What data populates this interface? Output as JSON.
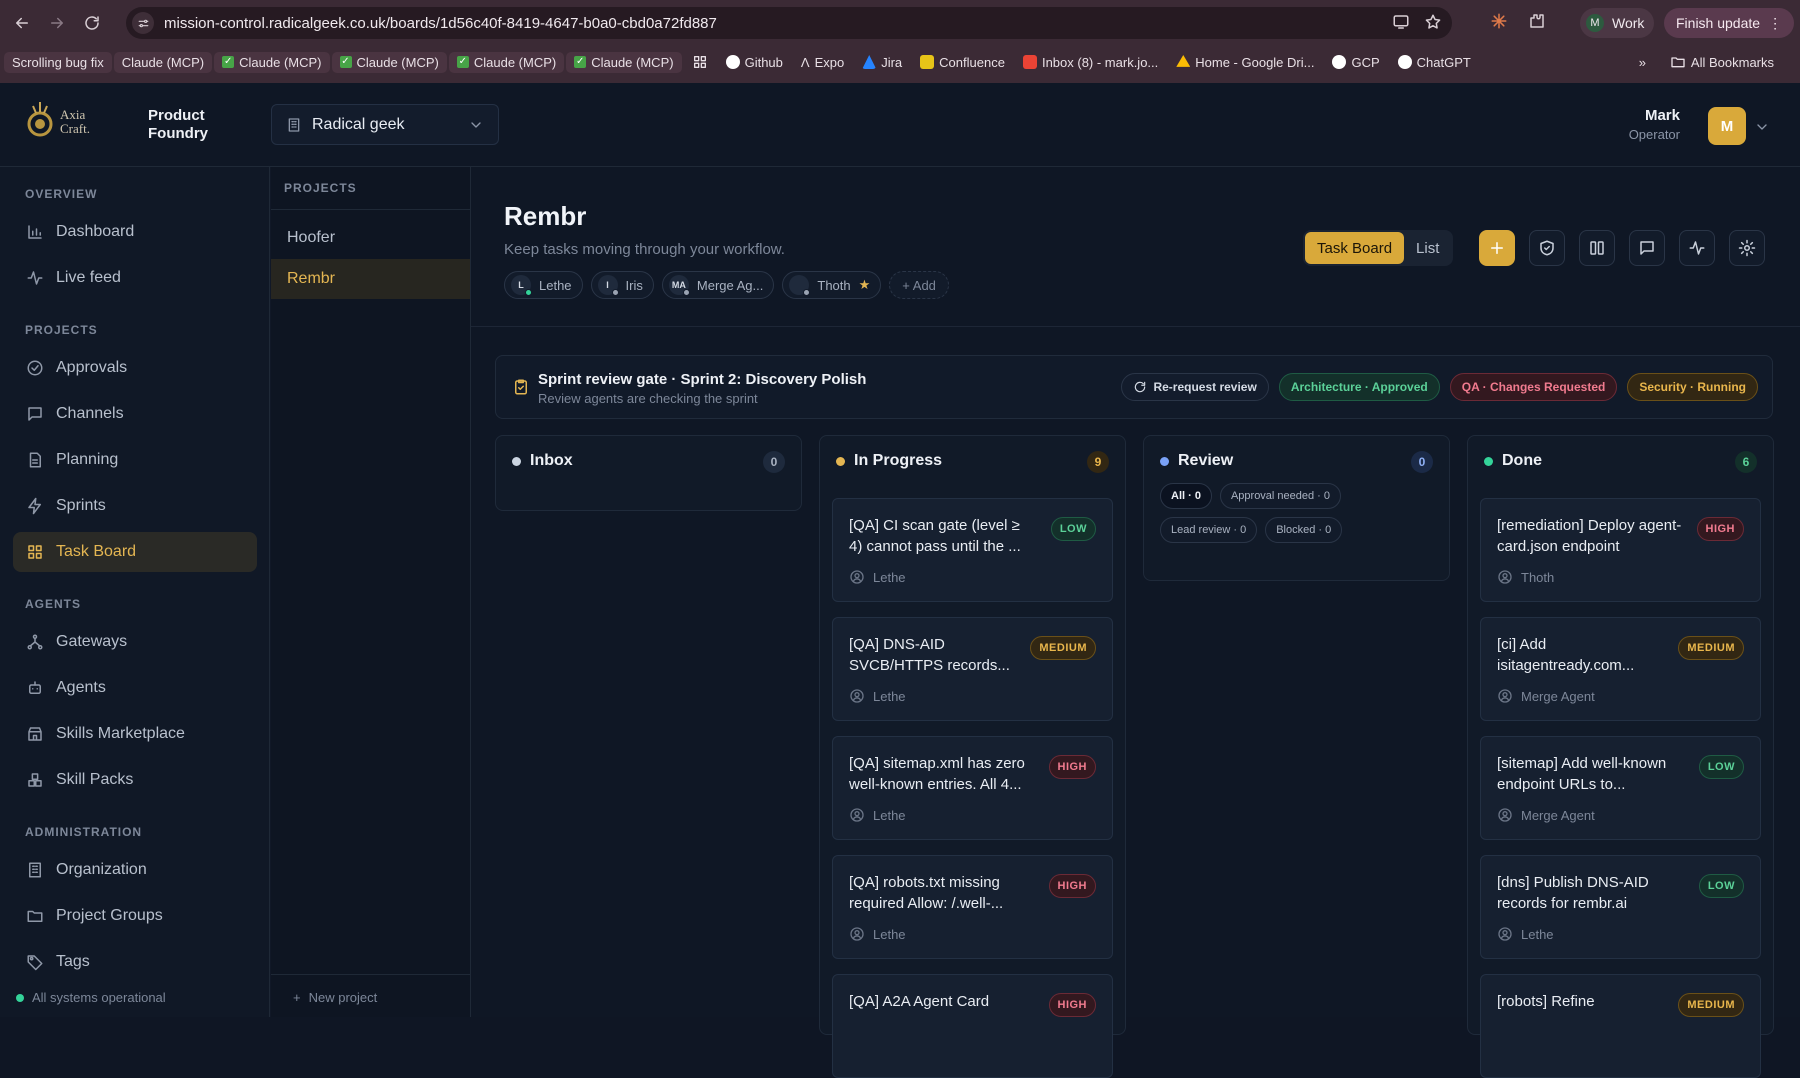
{
  "browser": {
    "url": "mission-control.radicalgeek.co.uk/boards/1d56c40f-8419-4647-b0a0-cbd0a72fd887",
    "profile_initial": "M",
    "profile_label": "Work",
    "finish_update": "Finish update",
    "bookmarks": [
      {
        "label": "Scrolling bug fix"
      },
      {
        "label": "Claude (MCP)"
      },
      {
        "label": "Claude (MCP)"
      },
      {
        "label": "Claude (MCP)"
      },
      {
        "label": "Claude (MCP)"
      },
      {
        "label": "Claude (MCP)"
      },
      {
        "label": "Github"
      },
      {
        "label": "Expo"
      },
      {
        "label": "Jira"
      },
      {
        "label": "Confluence"
      },
      {
        "label": "Inbox (8) - mark.jo..."
      },
      {
        "label": "Home - Google Dri..."
      },
      {
        "label": "GCP"
      },
      {
        "label": "ChatGPT"
      }
    ],
    "all_bookmarks": "All Bookmarks"
  },
  "header": {
    "logo_line1": "Axia",
    "logo_line2": "Craft.",
    "product": "Product Foundry",
    "org": "Radical geek",
    "user_name": "Mark",
    "user_role": "Operator",
    "user_initial": "M"
  },
  "sidebar": {
    "sections": {
      "overview": "OVERVIEW",
      "projects": "PROJECTS",
      "agents": "AGENTS",
      "administration": "ADMINISTRATION"
    },
    "items": {
      "dashboard": "Dashboard",
      "live_feed": "Live feed",
      "approvals": "Approvals",
      "channels": "Channels",
      "planning": "Planning",
      "sprints": "Sprints",
      "task_board": "Task Board",
      "gateways": "Gateways",
      "agents": "Agents",
      "skills_marketplace": "Skills Marketplace",
      "skill_packs": "Skill Packs",
      "organization": "Organization",
      "project_groups": "Project Groups",
      "tags": "Tags"
    },
    "status": "All systems operational"
  },
  "projects_panel": {
    "title": "PROJECTS",
    "items": [
      "Hoofer",
      "Rembr"
    ],
    "new_project": "New project"
  },
  "board": {
    "title": "Rembr",
    "subtitle": "Keep tasks moving through your workflow.",
    "agents": [
      {
        "initials": "L",
        "name": "Lethe"
      },
      {
        "initials": "I",
        "name": "Iris"
      },
      {
        "initials": "MA",
        "name": "Merge Ag..."
      },
      {
        "initials": "",
        "name": "Thoth"
      }
    ],
    "add_agent": "+ Add",
    "views": {
      "board": "Task Board",
      "list": "List"
    }
  },
  "gate": {
    "title": "Sprint review gate · Sprint 2: Discovery Polish",
    "subtitle": "Review agents are checking the sprint",
    "rerequest": "Re-request review",
    "architecture": "Architecture · Approved",
    "qa": "QA · Changes Requested",
    "security": "Security · Running"
  },
  "columns": {
    "inbox": {
      "title": "Inbox",
      "count": "0",
      "color": "#cbd5e1"
    },
    "in_progress": {
      "title": "In Progress",
      "count": "9",
      "color": "#e4b652",
      "cards": [
        {
          "title": "[QA] CI scan gate (level ≥ 4) cannot pass until the ...",
          "priority": "LOW",
          "assignee": "Lethe"
        },
        {
          "title": "[QA] DNS-AID SVCB/HTTPS records...",
          "priority": "MEDIUM",
          "assignee": "Lethe"
        },
        {
          "title": "[QA] sitemap.xml has zero well-known entries. All 4...",
          "priority": "HIGH",
          "assignee": "Lethe"
        },
        {
          "title": "[QA] robots.txt missing required Allow: /.well-...",
          "priority": "HIGH",
          "assignee": "Lethe"
        },
        {
          "title": "[QA] A2A Agent Card",
          "priority": "HIGH",
          "assignee": ""
        }
      ]
    },
    "review": {
      "title": "Review",
      "count": "0",
      "color": "#7aa2f7",
      "filters": {
        "all": "All · 0",
        "approval": "Approval needed · 0",
        "lead": "Lead review · 0",
        "blocked": "Blocked · 0"
      }
    },
    "done": {
      "title": "Done",
      "count": "6",
      "color": "#34d399",
      "cards": [
        {
          "title": "[remediation] Deploy agent-card.json endpoint",
          "priority": "HIGH",
          "assignee": "Thoth"
        },
        {
          "title": "[ci] Add isitagentready.com...",
          "priority": "MEDIUM",
          "assignee": "Merge Agent"
        },
        {
          "title": "[sitemap] Add well-known endpoint URLs to...",
          "priority": "LOW",
          "assignee": "Merge Agent"
        },
        {
          "title": "[dns] Publish DNS-AID records for rembr.ai",
          "priority": "LOW",
          "assignee": "Lethe"
        },
        {
          "title": "[robots] Refine",
          "priority": "MEDIUM",
          "assignee": ""
        }
      ]
    }
  }
}
